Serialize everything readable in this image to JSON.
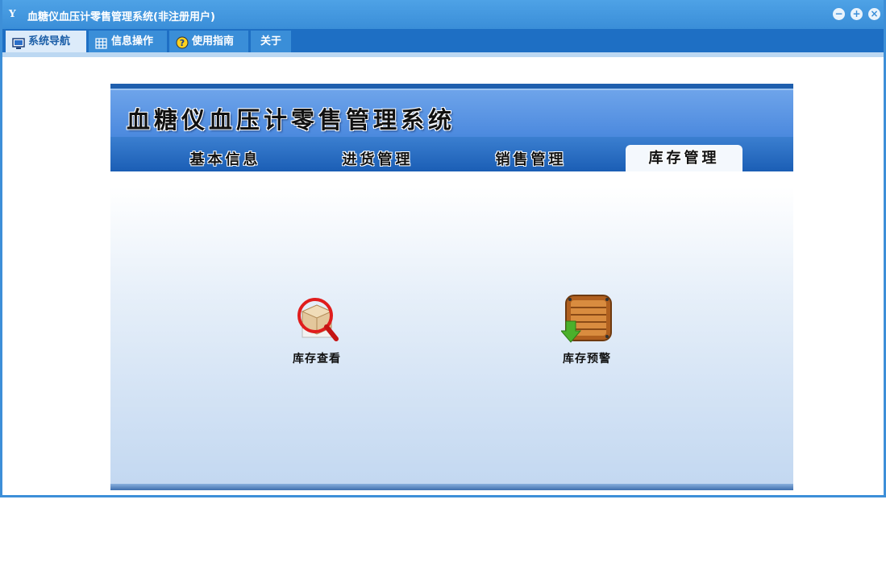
{
  "window": {
    "title": "血糖仪血压计零售管理系统(非注册用户)",
    "app_icon_glyph": "Y",
    "controls": {
      "minimize": "−",
      "maximize": "+",
      "close": "×"
    }
  },
  "menubar": {
    "tabs": [
      {
        "label": "系统导航",
        "icon": "monitor-icon",
        "active": true
      },
      {
        "label": "信息操作",
        "icon": "grid-icon",
        "active": false
      },
      {
        "label": "使用指南",
        "icon": "help-icon",
        "active": false
      },
      {
        "label": "关于",
        "icon": "",
        "active": false
      }
    ]
  },
  "panel": {
    "banner_title": "血糖仪血压计零售管理系统",
    "nav_tabs": [
      {
        "label": "基本信息",
        "active": false
      },
      {
        "label": "进货管理",
        "active": false
      },
      {
        "label": "销售管理",
        "active": false
      },
      {
        "label": "库存管理",
        "active": true
      }
    ],
    "tiles": [
      {
        "label": "库存查看",
        "icon": "inventory-search-icon"
      },
      {
        "label": "库存预警",
        "icon": "inventory-alert-icon"
      }
    ]
  },
  "colors": {
    "titlebar": "#3a8ed8",
    "menubar": "#1e6fc4",
    "banner": "#4b89de",
    "nav": "#1b5eb5"
  }
}
